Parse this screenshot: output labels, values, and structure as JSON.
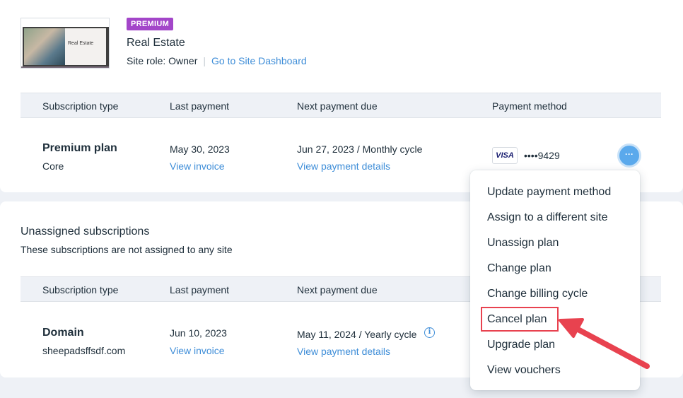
{
  "site": {
    "badge": "PREMIUM",
    "thumbnail_title": "Real Estate",
    "name": "Real Estate",
    "role": "Site role: Owner",
    "dashboard_link": "Go to Site Dashboard"
  },
  "table_headers": {
    "subscription_type": "Subscription type",
    "last_payment": "Last payment",
    "next_payment_due": "Next payment due",
    "payment_method": "Payment method"
  },
  "premium_row": {
    "plan_name": "Premium plan",
    "plan_tier": "Core",
    "last_payment_date": "May 30, 2023",
    "view_invoice": "View invoice",
    "next_due": "Jun 27, 2023",
    "cycle_separator": "/",
    "cycle": "Monthly cycle",
    "view_payment_details": "View payment details",
    "card_brand": "VISA",
    "card_digits": "••••9429",
    "more_button": "···"
  },
  "unassigned": {
    "title": "Unassigned subscriptions",
    "subtitle": "These subscriptions are not assigned to any site"
  },
  "domain_row": {
    "name": "Domain",
    "domain": "sheepadsffsdf.com",
    "last_payment_date": "Jun 10, 2023",
    "view_invoice": "View invoice",
    "next_due": "May 11, 2024",
    "cycle_separator": "/",
    "cycle": "Yearly cycle",
    "info_icon": "i",
    "view_payment_details": "View payment details"
  },
  "menu": {
    "items": [
      "Update payment method",
      "Assign to a different site",
      "Unassign plan",
      "Change plan",
      "Change billing cycle",
      "Cancel plan",
      "Upgrade plan",
      "View vouchers"
    ],
    "highlighted_item": "Cancel plan"
  },
  "colors": {
    "badge": "#a346c9",
    "link": "#3f8ed8",
    "more_button": "#5aa9ec",
    "annotation": "#e8424f",
    "page_bg": "#eef1f6"
  },
  "icons": {
    "more": "more-horizontal-icon",
    "info": "info-icon",
    "card": "visa-card-icon"
  }
}
